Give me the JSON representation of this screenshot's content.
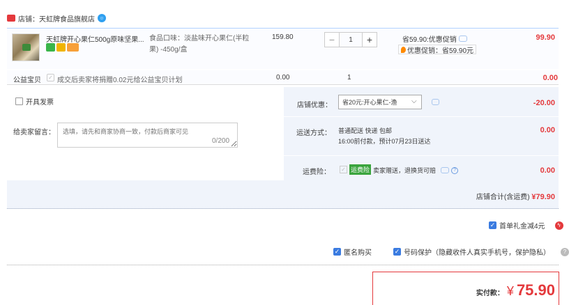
{
  "shop": {
    "name": "店铺：天虹牌食品旗舰店"
  },
  "item": {
    "title": "天虹牌开心果仁500g原味坚果...",
    "sku": "食品口味：淡盐味开心果仁(半粒果) -450g/盒",
    "unit_price": "159.80",
    "quantity": "1",
    "promo_line1": "省59.90:优惠促销",
    "promo_line2": "优惠促销：省59.90元",
    "total": "99.90"
  },
  "charity": {
    "label": "公益宝贝",
    "text": "成交后卖家将捐赠0.02元给公益宝贝计划",
    "price": "0.00",
    "quantity": "1",
    "total": "0.00"
  },
  "options": {
    "invoice_label": "开具发票",
    "message_label": "给卖家留言：",
    "message_placeholder": "选填，请先和商家协商一致，付款后商家可见",
    "message_count": "0/200",
    "shop_discount_label": "店铺优惠：",
    "shop_discount_value": "省20元:开心果仁-渔",
    "shop_discount_amount": "-20.00",
    "shipping_label": "运送方式：",
    "shipping_line1": "普通配送 快递 包邮",
    "shipping_line2": "16:00前付款，预计07月23日送达",
    "shipping_amount": "0.00",
    "insurance_label": "运费险：",
    "insurance_badge": "运费险",
    "insurance_text": "卖家赠送，退换货可赔",
    "insurance_amount": "0.00"
  },
  "shop_total": {
    "label": "店铺合计(含运费)",
    "amount": "¥79.90"
  },
  "first_order": {
    "label": "首单礼金减4元",
    "icon": "lightning-icon"
  },
  "privacy": {
    "anonymous_label": "匿名购买",
    "phone_protect_label": "号码保护（隐藏收件人真实手机号，保护隐私）"
  },
  "payment": {
    "label": "实付款：",
    "currency": "¥",
    "amount": "75.90"
  },
  "colors": {
    "accent_red": "#e4393c",
    "checkbox_blue": "#3a7be0",
    "insurance_green": "#3aa43d"
  }
}
